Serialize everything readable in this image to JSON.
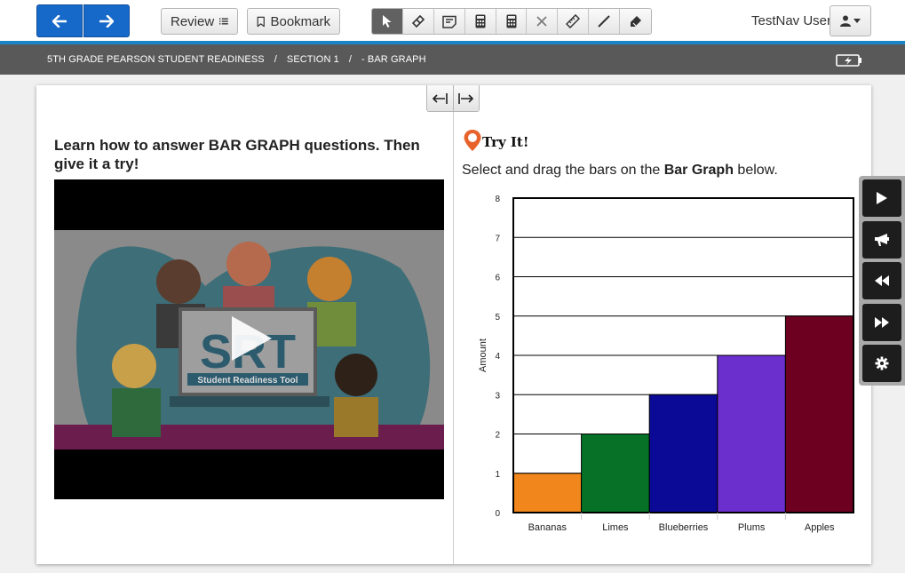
{
  "toolbar": {
    "review_label": "Review",
    "bookmark_label": "Bookmark",
    "tools": [
      {
        "name": "pointer-tool",
        "icon": "pointer-icon"
      },
      {
        "name": "eraser-tool",
        "icon": "eraser-icon"
      },
      {
        "name": "notepad-tool",
        "icon": "notepad-icon"
      },
      {
        "name": "calculator-tool",
        "icon": "calculator-icon"
      },
      {
        "name": "scientific-calculator-tool",
        "icon": "calculator-icon"
      },
      {
        "name": "answer-eliminator-tool",
        "icon": "eliminator-icon"
      },
      {
        "name": "ruler-tool",
        "icon": "ruler-icon"
      },
      {
        "name": "line-tool",
        "icon": "line-icon"
      },
      {
        "name": "highlighter-tool",
        "icon": "highlighter-icon"
      }
    ],
    "user_name": "TestNav User"
  },
  "breadcrumb": {
    "items": [
      "5TH GRADE PEARSON STUDENT READINESS",
      "SECTION 1",
      "- BAR GRAPH"
    ],
    "separator": "/"
  },
  "left_panel": {
    "heading": "Learn how to answer BAR GRAPH questions. Then give it a try!",
    "video": {
      "logo_text": "SRT",
      "logo_subtitle": "Student Readiness Tool"
    }
  },
  "right_panel": {
    "tryit_title": "Try It!",
    "instructions_prefix": "Select and drag the bars on the ",
    "instructions_bold": "Bar Graph",
    "instructions_suffix": " below."
  },
  "colors": {
    "accent_blue": "#1769c9",
    "header_rule": "#1a84c7",
    "breadcrumb_bg": "#595959",
    "tryit_pin": "#e8632b"
  },
  "chart_data": {
    "type": "bar",
    "categories": [
      "Bananas",
      "Limes",
      "Blueberries",
      "Plums",
      "Apples"
    ],
    "values": [
      1,
      2,
      3,
      4,
      5
    ],
    "colors": [
      "#f0861c",
      "#077227",
      "#0a0a96",
      "#6a2fcc",
      "#6d0020"
    ],
    "title": "",
    "xlabel": "",
    "ylabel": "Amount",
    "ylim": [
      0,
      8
    ],
    "yticks": [
      0,
      1,
      2,
      3,
      4,
      5,
      6,
      7,
      8
    ],
    "grid": true
  },
  "side_toolbar": [
    {
      "name": "play-button",
      "icon": "play-icon"
    },
    {
      "name": "announce-button",
      "icon": "megaphone-icon"
    },
    {
      "name": "rewind-button",
      "icon": "rewind-icon"
    },
    {
      "name": "fast-forward-button",
      "icon": "fast-forward-icon"
    },
    {
      "name": "settings-button",
      "icon": "gear-icon"
    }
  ]
}
